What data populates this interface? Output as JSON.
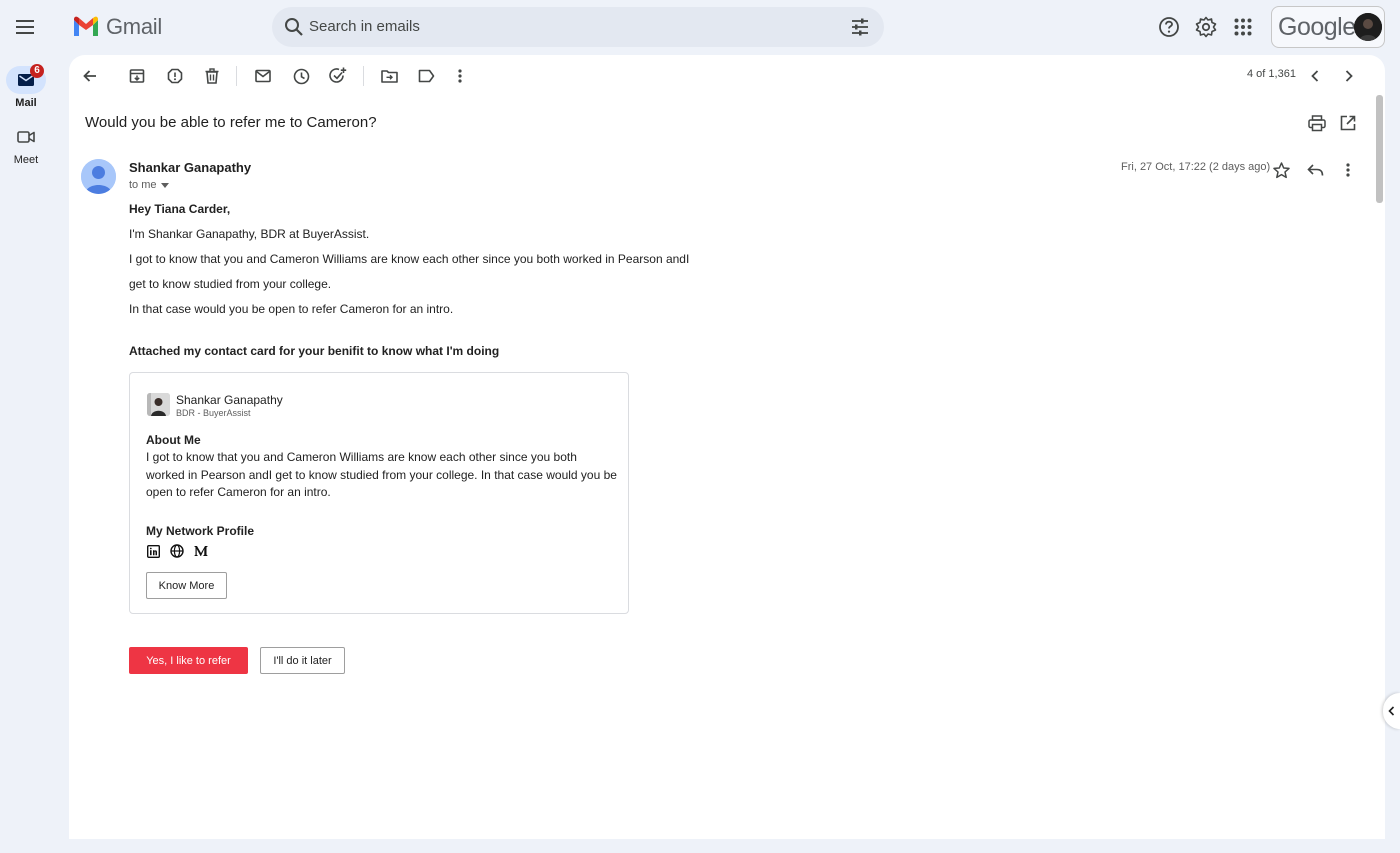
{
  "app": {
    "name": "Gmail"
  },
  "search": {
    "placeholder": "Search in emails"
  },
  "account": {
    "brand": "Google"
  },
  "rail": {
    "mail": {
      "label": "Mail",
      "badge": "6"
    },
    "meet": {
      "label": "Meet"
    }
  },
  "toolbar": {
    "icons": [
      "back-arrow-icon",
      "archive-icon",
      "report-spam-icon",
      "delete-icon",
      "mark-unread-icon",
      "snooze-icon",
      "add-task-icon",
      "move-to-icon",
      "label-icon",
      "more-vert-icon"
    ],
    "pager": "4 of 1,361"
  },
  "email": {
    "subject": "Would you be able to refer me to Cameron?",
    "sender": "Shankar Ganapathy",
    "to": "to me",
    "date": "Fri, 27 Oct, 17:22 (2 days ago)",
    "body": {
      "greeting": "Hey Tiana Carder,",
      "line1": "I'm Shankar Ganapathy, BDR at BuyerAssist.",
      "line2": "I got to know that you and Cameron Williams are know each other since you both worked in Pearson andI",
      "line3": "get to know studied from your college.",
      "line4": "In that case would you be open to refer Cameron for an intro.",
      "attached": "Attached my contact card for your benifit to know what I'm doing"
    },
    "card": {
      "name": "Shankar Ganapathy",
      "role": "BDR - BuyerAssist",
      "about_heading": "About Me",
      "about_text": "I got to know that you and Cameron Williams are know each other since you both worked in Pearson andI get to know studied from your college. In that case would you be open to refer Cameron for an intro.",
      "network_heading": "My Network Profile",
      "links": [
        "linkedin-icon",
        "globe-icon",
        "medium-icon"
      ],
      "button": "Know More"
    },
    "actions": {
      "yes": "Yes, I like to refer",
      "later": "I'll do it later"
    }
  },
  "colors": {
    "accent_red": "#ee3544",
    "background": "#eef2f9",
    "badge": "#c5221f"
  }
}
